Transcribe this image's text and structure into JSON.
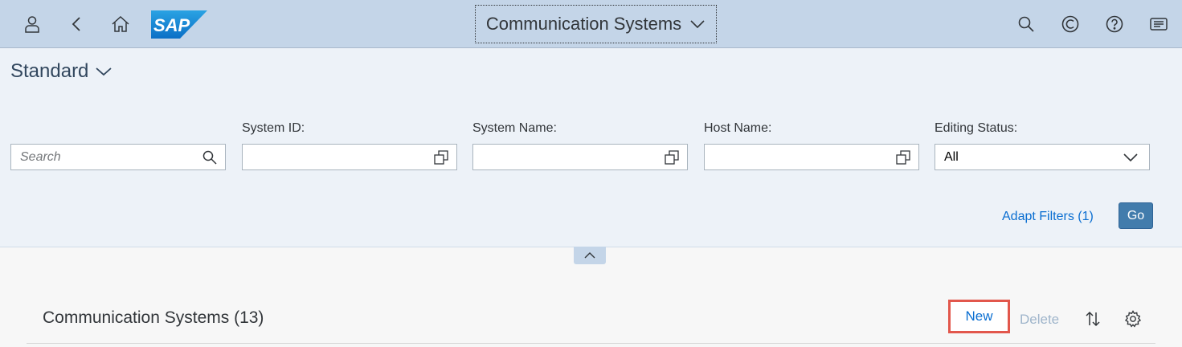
{
  "shell": {
    "logo_text": "SAP",
    "app_title": "Communication Systems",
    "icons": {
      "left": [
        "user-icon",
        "back-icon",
        "home-icon"
      ],
      "right": [
        "search-icon",
        "copilot-icon",
        "help-icon",
        "notifications-icon"
      ]
    }
  },
  "filterbar": {
    "variant": "Standard",
    "search": {
      "placeholder": "Search"
    },
    "fields": [
      {
        "label": "System ID:",
        "value": ""
      },
      {
        "label": "System Name:",
        "value": ""
      },
      {
        "label": "Host Name:",
        "value": ""
      },
      {
        "label": "Editing Status:",
        "value": "All"
      }
    ],
    "adapt_filters": "Adapt Filters (1)",
    "go": "Go"
  },
  "table": {
    "title": "Communication Systems (13)",
    "new_label": "New",
    "delete_label": "Delete"
  },
  "colors": {
    "shell_bg": "#c4d5e8",
    "filter_bg": "#edf2f8",
    "accent": "#0a6ed1",
    "go_bg": "#427cac",
    "highlight": "#e2574c"
  }
}
